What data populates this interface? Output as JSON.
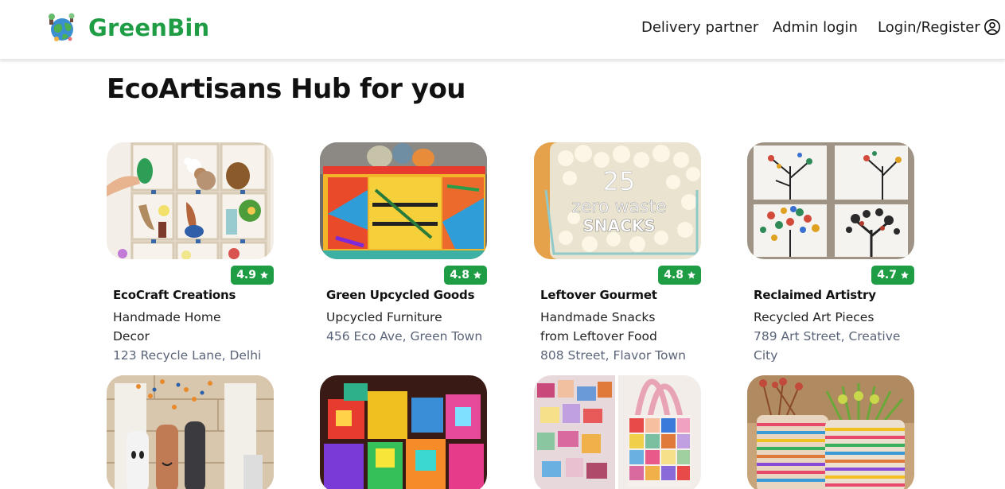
{
  "brand": {
    "name": "GreenBin"
  },
  "nav": {
    "delivery": "Delivery partner",
    "admin": "Admin login",
    "login": "Login/Register"
  },
  "page": {
    "title": "EcoArtisans Hub for you"
  },
  "colors": {
    "accent": "#1f9d45",
    "address": "#5a6478"
  },
  "cards": [
    {
      "name": "EcoCraft Creations",
      "category": "Handmade Home Decor",
      "address": "123 Recycle Lane, Delhi",
      "rating": "4.9"
    },
    {
      "name": "Green Upcycled Goods",
      "category": "Upcycled Furniture",
      "address": "456 Eco Ave, Green Town",
      "rating": "4.8"
    },
    {
      "name": "Leftover Gourmet",
      "category": "Handmade Snacks from Leftover Food",
      "address": "808 Street, Flavor Town",
      "rating": "4.8",
      "image_text": {
        "number": "25",
        "line1": "zero waste",
        "line2": "SNACKS"
      }
    },
    {
      "name": "Reclaimed Artistry",
      "category": "Recycled Art Pieces",
      "address": "789 Art Street, Creative City",
      "rating": "4.7"
    },
    {
      "name": "",
      "category": "",
      "address": "",
      "rating": ""
    },
    {
      "name": "",
      "category": "",
      "address": "",
      "rating": ""
    },
    {
      "name": "",
      "category": "",
      "address": "",
      "rating": ""
    },
    {
      "name": "",
      "category": "",
      "address": "",
      "rating": ""
    }
  ],
  "icons": {
    "user": "user-circle-icon",
    "star": "star-icon",
    "logo": "globe-recycle-icon"
  }
}
